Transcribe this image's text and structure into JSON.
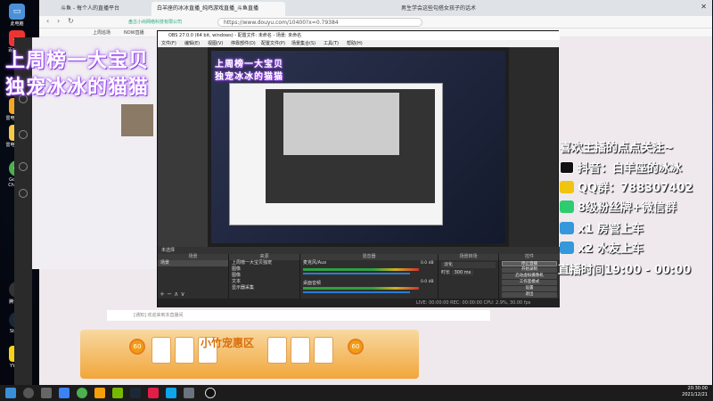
{
  "browser": {
    "tabs": [
      {
        "label": "斗鱼 - 每个人的直播平台",
        "active": false
      },
      {
        "label": "白羊座的冰冰直播_纯鸡游戏直播_斗鱼直播",
        "active": true
      },
      {
        "label": "男生学会这些勾搭女孩子的话术",
        "active": false
      }
    ],
    "address_prefix": "盘古小尚网络科技有限公司",
    "address": "https://www.douyu.com/10400?x=0.79384",
    "bookmarks": [
      "上周巡场",
      "NOW直播"
    ]
  },
  "stream_overlay": {
    "line1": "上周榜一大宝贝",
    "line2": "独宠冰冰的猫猫"
  },
  "right_overlay": {
    "follow_prompt": "喜欢主播的点点关注~",
    "items": [
      {
        "icon": "tiktok-icon",
        "text": "抖音：白羊座的冰冰",
        "color": "#111"
      },
      {
        "icon": "qq-icon",
        "text": "QQ群：788307402",
        "color": "#f1c40f"
      },
      {
        "icon": "wechat-icon",
        "text": "8级粉丝牌+微信群",
        "color": "#2ecc71"
      },
      {
        "icon": "ticket-icon",
        "text": "x1 房管上车",
        "color": "#3498db"
      },
      {
        "icon": "ticket-icon",
        "text": "x2 水友上车",
        "color": "#3498db"
      }
    ],
    "schedule": "直播时间19:00 - 00:00"
  },
  "obs": {
    "title": "OBS 27.0.0 (64 bit, windows) - 配置文件: 未命名 - 场景: 未命名",
    "menu": [
      "文件(F)",
      "编辑(E)",
      "视图(V)",
      "停靠部件(D)",
      "配置文件(P)",
      "场景集合(S)",
      "工具(T)",
      "帮助(H)"
    ],
    "scene_collection_label": "未选择",
    "docks": {
      "scenes": {
        "title": "场景",
        "items": [
          "场景"
        ]
      },
      "sources": {
        "title": "来源",
        "items": [
          "上周榜一大宝贝独宠",
          "图像",
          "图像",
          "文本",
          "显示器采集"
        ]
      },
      "mixer": {
        "title": "混音器",
        "channels": [
          {
            "name": "麦克风/Aux",
            "level": "0.0 dB"
          },
          {
            "name": "桌面音频",
            "level": "0.0 dB"
          }
        ]
      },
      "transitions": {
        "title": "场景转场",
        "type": "淡化",
        "duration_label": "时长",
        "duration": "300 ms"
      },
      "controls": {
        "title": "控件",
        "buttons": [
          "停止直播",
          "开始录制",
          "启动虚拟摄像机",
          "工作室模式",
          "设置",
          "退出"
        ]
      }
    },
    "status": "LIVE: 00:00:00   REC: 00:00:00   CPU: 2.9%, 30.00 fps"
  },
  "page": {
    "gift_title": "小竹宠惠区",
    "follow_text": "[通知] 欢迎来到本直播间"
  },
  "desktop_icons": [
    "此电脑",
    "百度网盘",
    "雷电模拟器",
    "雷电多开器",
    "Google Chrome",
    "腾讯QQ",
    "Steam",
    "YY语音"
  ],
  "clock": {
    "time": "20:30:00",
    "date": "2021/12/21"
  }
}
